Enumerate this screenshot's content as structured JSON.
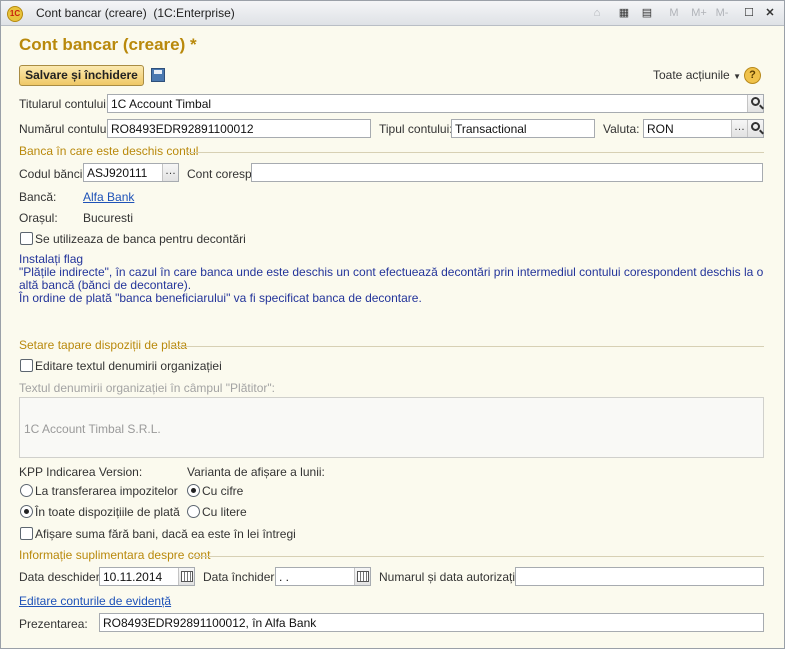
{
  "window": {
    "title": "Cont bancar (creare)",
    "app": "(1C:Enterprise)",
    "logo": "1C",
    "toolbar": {
      "m": "M",
      "mplus": "M+",
      "mminus": "M-",
      "close": "✕"
    }
  },
  "form": {
    "heading": "Cont bancar (creare) *",
    "save_close": "Salvare și închidere",
    "all_actions": "Toate acțiunile",
    "help": "?",
    "holder": {
      "label": "Titularul contului:",
      "value": "1C Account Timbal"
    },
    "account_no": {
      "label": "Numărul contului:",
      "value": "RO8493EDR92891100012"
    },
    "account_type": {
      "label": "Tipul contului:",
      "value": "Transactional"
    },
    "currency": {
      "label": "Valuta:",
      "value": "RON"
    },
    "bank_section": "Banca în care este deschis contul",
    "bank_code": {
      "label": "Codul băncii:",
      "value": "ASJ920111"
    },
    "corr_account": {
      "label": "Cont coresp.:",
      "value": ""
    },
    "bank": {
      "label": "Bancă:",
      "value": "Alfa Bank"
    },
    "city": {
      "label": "Orașul:",
      "value": "Bucuresti"
    },
    "settlement_bank_check": "Se utilizeaza de banca pentru decontări",
    "info_lines": [
      "Instalați flag",
      " \"Plățile indirecte\", în cazul în care banca unde este deschis un cont efectuează decontări prin intermediul contului corespondent deschis la o altă bancă (bănci de decontare).",
      "În ordine de plată \"banca beneficiarului\" va fi specificat banca de decontare."
    ],
    "print_section": "Setare tapare dispoziții de plata",
    "edit_org_name_check": "Editare textul denumirii organizației",
    "org_name_label": "Textul denumirii organizației în câmpul \"Plătitor\":",
    "org_name_value": "1C Account Timbal S.R.L.",
    "kpp_label": "KPP Indicarea Version:",
    "kpp_option1": "La transferarea impozitelor",
    "kpp_option2": "În toate dispozițiile de plată",
    "month_label": "Varianta de afișare a lunii:",
    "month_option1": "Cu cifre",
    "month_option2": "Cu litere",
    "whole_lei_check": "Afișare suma fără bani, dacă ea este în lei întregi",
    "extra_section": "Informație suplimentara despre cont",
    "open_date": {
      "label": "Data deschiderii:",
      "value": "10.11.2014"
    },
    "close_date": {
      "label": "Data închiderii:",
      "value": " .  . "
    },
    "authorization": {
      "label": "Numarul și data autorizației:",
      "value": ""
    },
    "edit_accounts_link": "Editare conturile de evidență",
    "presentation": {
      "label": "Prezentarea:",
      "value": "RO8493EDR92891100012, în Alfa Bank"
    }
  }
}
